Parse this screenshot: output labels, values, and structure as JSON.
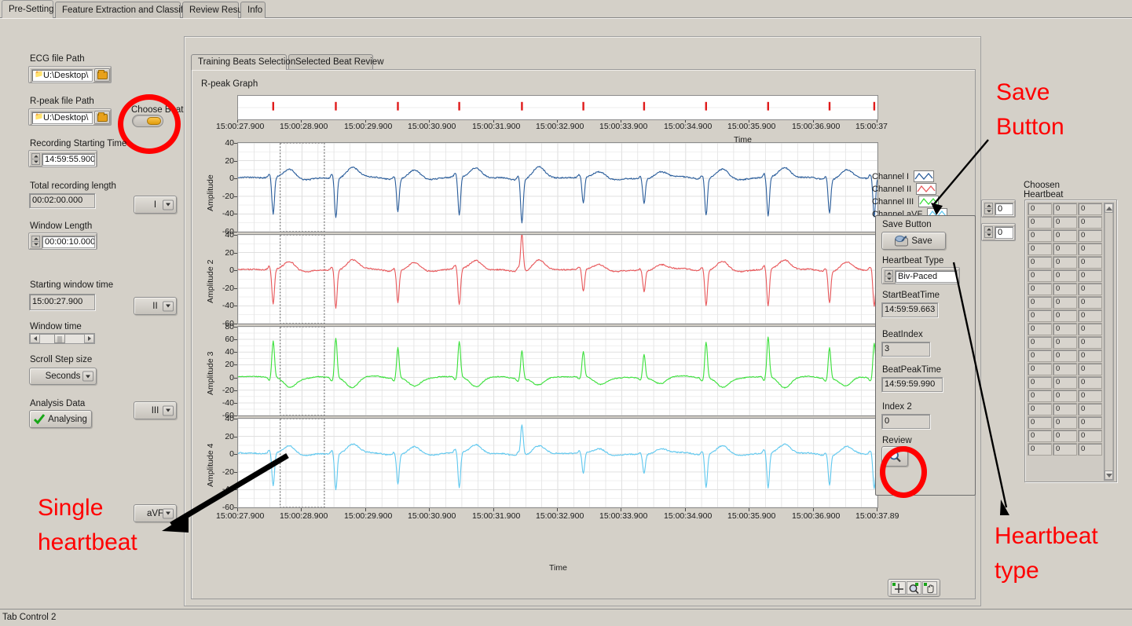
{
  "window": {
    "status_text": "Tab Control 2",
    "tab_control_label": "Tab Control"
  },
  "top_tabs": [
    {
      "label": "Pre-Setting",
      "active": true
    },
    {
      "label": "Feature Extraction and Classification",
      "active": false
    },
    {
      "label": "Review Result",
      "active": false
    },
    {
      "label": "Info",
      "active": false
    }
  ],
  "left_panel": {
    "ecg_path": {
      "label": "ECG file Path",
      "value": "U:\\Desktop\\"
    },
    "rpeak_path": {
      "label": "R-peak file Path",
      "value": "U:\\Desktop\\"
    },
    "choose_beat": {
      "label": "Choose Beat",
      "state": "on"
    },
    "recording_start": {
      "label": "Recording Starting Time",
      "value": "14:59:55.900"
    },
    "total_length": {
      "label": "Total recording length",
      "value": "00:02:00.000"
    },
    "window_length": {
      "label": "Window Length",
      "value": "00:00:10.000"
    },
    "start_window_time": {
      "label": "Starting window time",
      "value": "15:00:27.900"
    },
    "window_time": {
      "label": "Window time"
    },
    "scroll_step": {
      "label": "Scroll Step size",
      "value": "Seconds"
    },
    "analysis_data": {
      "label": "Analysis Data",
      "button": "Analysing"
    },
    "channel_rings": [
      {
        "value": "I"
      },
      {
        "value": "II"
      },
      {
        "value": "III"
      },
      {
        "value": "aVF"
      }
    ]
  },
  "graph_area": {
    "sub_tabs": [
      {
        "label": "Training Beats Selection",
        "active": true
      },
      {
        "label": "Selected Beat Review",
        "active": false
      }
    ],
    "rpeak_graph_label": "R-peak Graph",
    "legend": [
      {
        "label": "Channel I",
        "color": "#2a5d9b"
      },
      {
        "label": "Channel II",
        "color": "#e8575a"
      },
      {
        "label": "Channel III",
        "color": "#3ae03a"
      },
      {
        "label": "Channel aVF",
        "color": "#5fc8ef"
      }
    ],
    "tool_palette": [
      "crosshair-cursor-icon",
      "zoom-icon",
      "pan-hand-icon"
    ]
  },
  "right_panel": {
    "save": {
      "label": "Save Button",
      "button": "Save"
    },
    "heartbeat_type": {
      "label": "Heartbeat Type",
      "value": "Biv-Paced"
    },
    "start_beat_time": {
      "label": "StartBeatTime",
      "value": "14:59:59.663"
    },
    "beat_index": {
      "label": "BeatIndex",
      "value": "3"
    },
    "beat_peak_time": {
      "label": "BeatPeakTime",
      "value": "14:59:59.990"
    },
    "index2": {
      "label": "Index 2",
      "value": "0"
    },
    "review": {
      "label": "Review"
    },
    "index_spinners": [
      "0",
      "0"
    ],
    "choosen_heartbeat": {
      "label_line1": "Choosen",
      "label_line2": "Heartbeat",
      "rows": 19,
      "cols": 3,
      "cell_value": "0"
    }
  },
  "annotations": [
    {
      "name": "save-button-annotation",
      "text": "Save\nButton",
      "color": "#ff0000"
    },
    {
      "name": "heartbeat-type-annotation",
      "text": "Heartbeat\ntype",
      "color": "#ff0000"
    },
    {
      "name": "single-heartbeat-annotation",
      "text": "Single\nheartbeat",
      "color": "#ff0000"
    }
  ],
  "chart_data": {
    "type": "line",
    "title": "R-peak Graph",
    "xlabel": "Time",
    "x_tick_labels": [
      "15:00:27.900",
      "15:00:28.900",
      "15:00:29.900",
      "15:00:30.900",
      "15:00:31.900",
      "15:00:32.900",
      "15:00:33.900",
      "15:00:34.900",
      "15:00:35.900",
      "15:00:36.900",
      "15:00:37.89"
    ],
    "rpeak_strip": {
      "ylabel": "",
      "x_tick_labels": [
        "15:00:27.900",
        "15:00:28.900",
        "15:00:29.900",
        "15:00:30.900",
        "15:00:31.900",
        "15:00:32.900",
        "15:00:33.900",
        "15:00:34.900",
        "15:00:35.900",
        "15:00:36.900",
        "15:00:37"
      ],
      "marker_color": "#e01b1b",
      "marker_positions_pct": [
        5.5,
        15.3,
        25.0,
        34.6,
        44.4,
        54.0,
        63.5,
        73.2,
        82.9,
        92.5,
        99.5
      ]
    },
    "subplots": [
      {
        "name": "channel-1",
        "ylabel": "Amplitude",
        "color": "#2a5d9b",
        "ylim": [
          -60,
          40
        ],
        "y_ticks": [
          40,
          20,
          0,
          -20,
          -40,
          -60
        ],
        "beat_peak_amplitudes": [
          -42,
          -45,
          -38,
          -44,
          -50,
          -30,
          -28
        ],
        "r_peak_polarity": "negative"
      },
      {
        "name": "channel-2",
        "ylabel": "Amplitude 2",
        "color": "#e8575a",
        "ylim": [
          -60,
          40
        ],
        "y_ticks": [
          40,
          20,
          0,
          -20,
          -40,
          -60
        ],
        "beat_peak_amplitudes": [
          -40,
          -43,
          -36,
          -42,
          44,
          -26,
          -24
        ],
        "r_peak_polarity": "negative"
      },
      {
        "name": "channel-3",
        "ylabel": "Amplitude 3",
        "color": "#3ae03a",
        "ylim": [
          -60,
          80
        ],
        "y_ticks": [
          80,
          60,
          40,
          20,
          0,
          -20,
          -40,
          -60
        ],
        "beat_peak_amplitudes": [
          58,
          64,
          50,
          56,
          46,
          40,
          38
        ],
        "r_peak_polarity": "positive"
      },
      {
        "name": "channel-4",
        "ylabel": "Amplitude 4",
        "color": "#5fc8ef",
        "ylim": [
          -60,
          40
        ],
        "y_ticks": [
          40,
          20,
          0,
          -20,
          -40,
          -60
        ],
        "beat_peak_amplitudes": [
          -38,
          -41,
          -34,
          -40,
          36,
          -24,
          -22
        ],
        "r_peak_polarity": "negative"
      }
    ],
    "cursor_selection": {
      "label": "selected-beat-region",
      "x_start_pct": 6.6,
      "x_end_pct": 13.5
    },
    "grid": true,
    "legend_position": "right"
  }
}
